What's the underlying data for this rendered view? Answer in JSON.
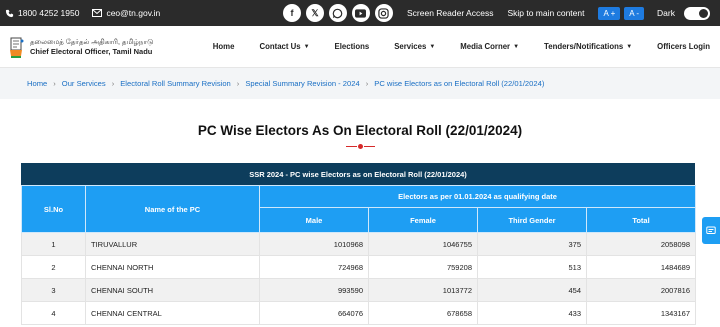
{
  "topbar": {
    "phone": "1800 4252 1950",
    "email": "ceo@tn.gov.in",
    "social_icons": [
      "facebook-icon",
      "x-icon",
      "whatsapp-icon",
      "youtube-icon",
      "instagram-icon"
    ],
    "screen_reader": "Screen Reader Access",
    "skip_main": "Skip to main content",
    "font_increase": "A +",
    "font_decrease": "A -",
    "dark_label": "Dark"
  },
  "header": {
    "logo_tamil": "தலைமைத் தேர்தல் அதிகாரி, தமிழ்நாடு",
    "logo_english": "Chief Electoral Officer, Tamil Nadu",
    "nav": [
      {
        "label": "Home",
        "has_caret": false
      },
      {
        "label": "Contact Us",
        "has_caret": true
      },
      {
        "label": "Elections",
        "has_caret": false
      },
      {
        "label": "Services",
        "has_caret": true
      },
      {
        "label": "Media Corner",
        "has_caret": true
      },
      {
        "label": "Tenders/Notifications",
        "has_caret": true
      },
      {
        "label": "Officers Login",
        "has_caret": false
      }
    ]
  },
  "breadcrumb": [
    "Home",
    "Our Services",
    "Electoral Roll Summary Revision",
    "Special Summary Revision - 2024",
    "PC wise Electors as on Electoral Roll (22/01/2024)"
  ],
  "page_title": "PC Wise Electors As On Electoral Roll (22/01/2024)",
  "table": {
    "caption": "SSR 2024 - PC wise Electors as on Electoral Roll (22/01/2024)",
    "headers": {
      "sl_no": "Sl.No",
      "pc_name": "Name of the PC",
      "group": "Electors as per 01.01.2024 as qualifying date",
      "male": "Male",
      "female": "Female",
      "third_gender": "Third Gender",
      "total": "Total"
    },
    "rows": [
      {
        "sl": "1",
        "name": "TIRUVALLUR",
        "male": "1010968",
        "female": "1046755",
        "tg": "375",
        "total": "2058098"
      },
      {
        "sl": "2",
        "name": "CHENNAI NORTH",
        "male": "724968",
        "female": "759208",
        "tg": "513",
        "total": "1484689"
      },
      {
        "sl": "3",
        "name": "CHENNAI SOUTH",
        "male": "993590",
        "female": "1013772",
        "tg": "454",
        "total": "2007816"
      },
      {
        "sl": "4",
        "name": "CHENNAI CENTRAL",
        "male": "664076",
        "female": "678658",
        "tg": "433",
        "total": "1343167"
      }
    ]
  },
  "colors": {
    "topbar_bg": "#2b2b2b",
    "caption_bg": "#0d3d5c",
    "table_header_bg": "#1e9ef3",
    "link": "#1a6fc4",
    "accent_red": "#d62a2a",
    "font_button": "#1e7be0"
  }
}
